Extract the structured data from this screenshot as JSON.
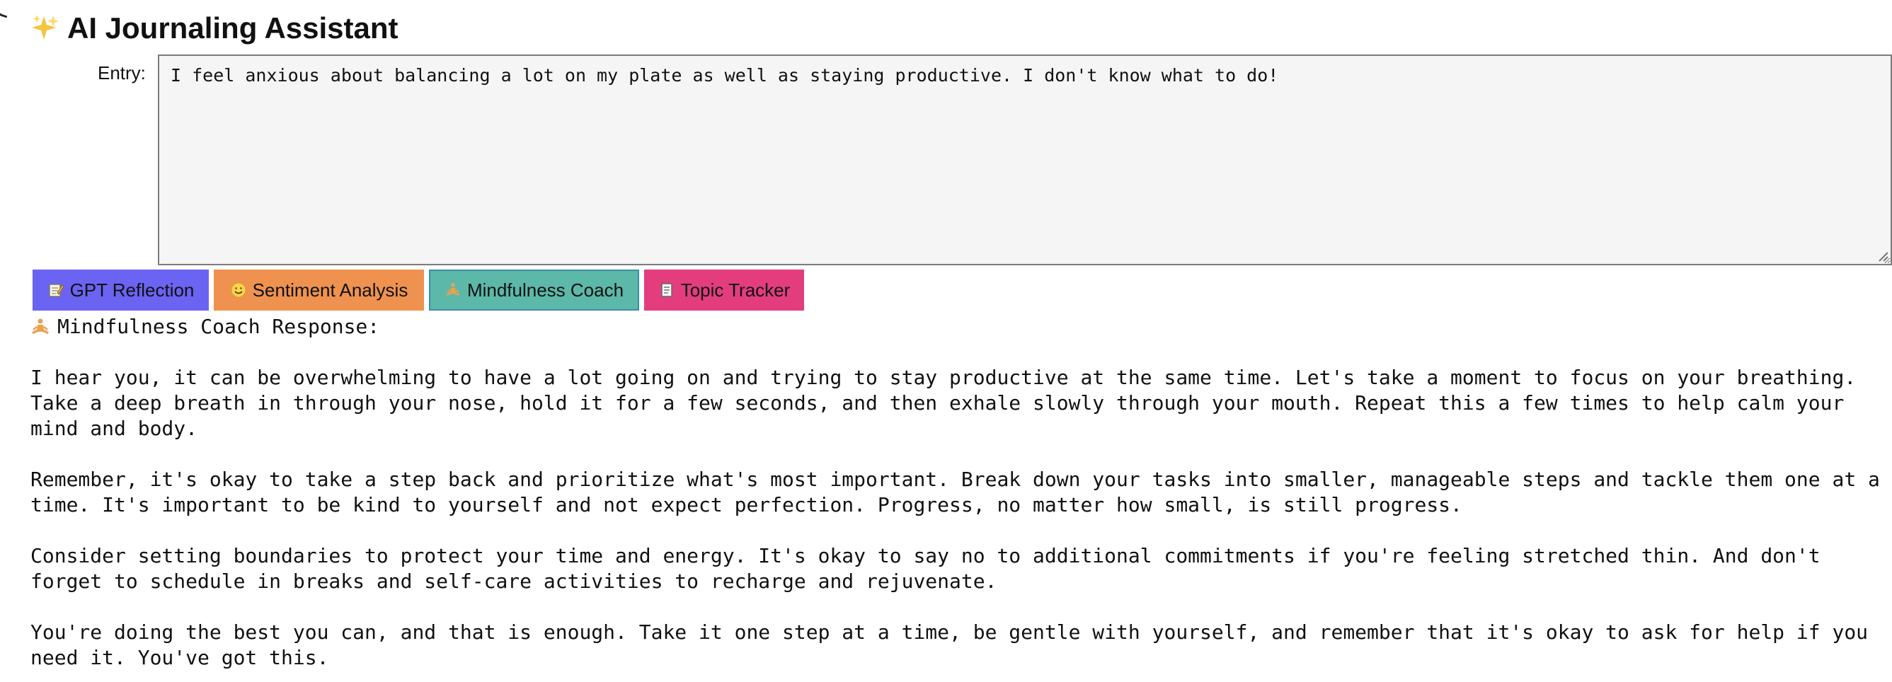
{
  "app": {
    "icon": "sparkles-icon",
    "title": "AI Journaling Assistant"
  },
  "entry": {
    "label": "Entry:",
    "value": "I feel anxious about balancing a lot on my plate as well as staying productive. I don't know what to do!"
  },
  "actions": [
    {
      "icon": "memo-icon",
      "label": "GPT Reflection",
      "color": "#6b63f2"
    },
    {
      "icon": "smiley-icon",
      "label": "Sentiment Analysis",
      "color": "#ef9250"
    },
    {
      "icon": "meditation-icon",
      "label": "Mindfulness Coach",
      "color": "#5cb8a9",
      "selected": true
    },
    {
      "icon": "document-icon",
      "label": "Topic Tracker",
      "color": "#e33d7e"
    }
  ],
  "response": {
    "icon": "meditation-icon",
    "heading": "Mindfulness Coach Response:",
    "paragraphs": [
      "I hear you, it can be overwhelming to have a lot going on and trying to stay productive at the same time. Let's take a moment to focus on your breathing. Take a deep breath in through your nose, hold it for a few seconds, and then exhale slowly through your mouth. Repeat this a few times to help calm your mind and body.",
      "Remember, it's okay to take a step back and prioritize what's most important. Break down your tasks into smaller, manageable steps and tackle them one at a time. It's important to be kind to yourself and not expect perfection. Progress, no matter how small, is still progress.",
      "Consider setting boundaries to protect your time and energy. It's okay to say no to additional commitments if you're feeling stretched thin. And don't forget to schedule in breaks and self-care activities to recharge and rejuvenate.",
      "You're doing the best you can, and that is enough. Take it one step at a time, be gentle with yourself, and remember that it's okay to ask for help if you need it. You've got this."
    ]
  }
}
